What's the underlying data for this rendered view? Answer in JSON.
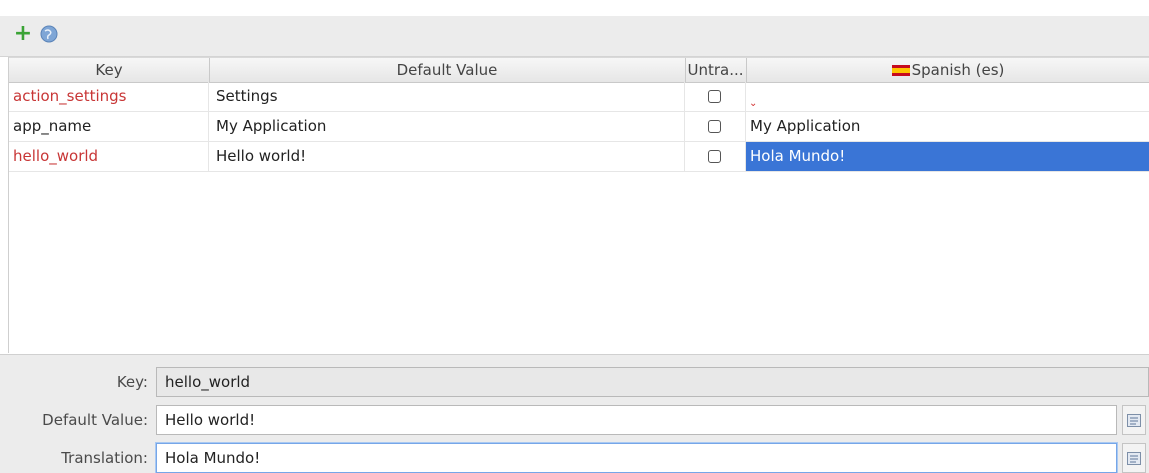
{
  "toolbar": {
    "add_icon": "plus-icon",
    "globe_icon": "globe-icon",
    "accent": "#3aa335"
  },
  "table": {
    "columns": {
      "key": "Key",
      "default": "Default Value",
      "untranslatable": "Untra...",
      "translation": "Spanish (es)",
      "translation_flag": "spain-flag-icon"
    },
    "rows": [
      {
        "key": "action_settings",
        "default": "Settings",
        "untranslatable": false,
        "translation": "",
        "missing": true
      },
      {
        "key": "app_name",
        "default": "My Application",
        "untranslatable": false,
        "translation": "My Application",
        "missing": false
      },
      {
        "key": "hello_world",
        "default": "Hello world!",
        "untranslatable": false,
        "translation": "Hola Mundo!",
        "missing": true
      }
    ],
    "selected_color": "#3a75d6",
    "missing_key_color": "#c83636"
  },
  "editor": {
    "key_label": "Key:",
    "key_value": "hello_world",
    "default_label": "Default Value:",
    "default_value": "Hello world!",
    "translation_label": "Translation:",
    "translation_value": "Hola Mundo!"
  }
}
